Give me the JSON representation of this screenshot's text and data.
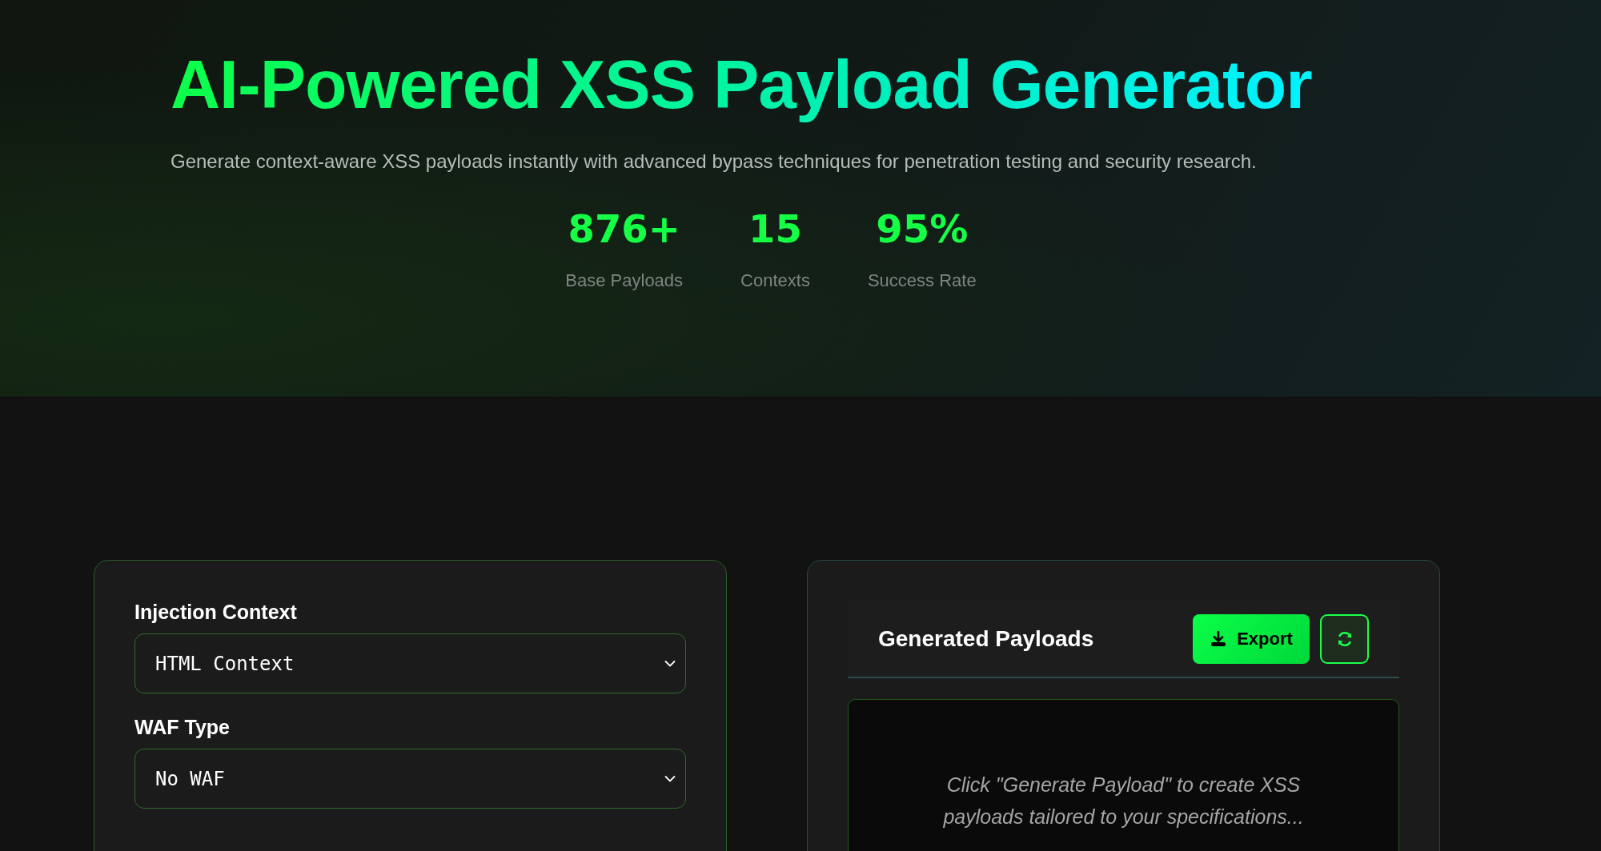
{
  "hero": {
    "title": "AI-Powered XSS Payload Generator",
    "subtitle": "Generate context-aware XSS payloads instantly with advanced bypass techniques for penetration testing and security research.",
    "stats": [
      {
        "value": "876+",
        "label": "Base Payloads"
      },
      {
        "value": "15",
        "label": "Contexts"
      },
      {
        "value": "95%",
        "label": "Success Rate"
      }
    ]
  },
  "config_panel": {
    "fields": [
      {
        "label": "Injection Context",
        "value": "HTML Context"
      },
      {
        "label": "WAF Type",
        "value": "No WAF"
      }
    ]
  },
  "output_panel": {
    "title": "Generated Payloads",
    "export_button": "Export",
    "empty_message": "Click \"Generate Payload\" to create XSS payloads tailored to your specifications..."
  }
}
